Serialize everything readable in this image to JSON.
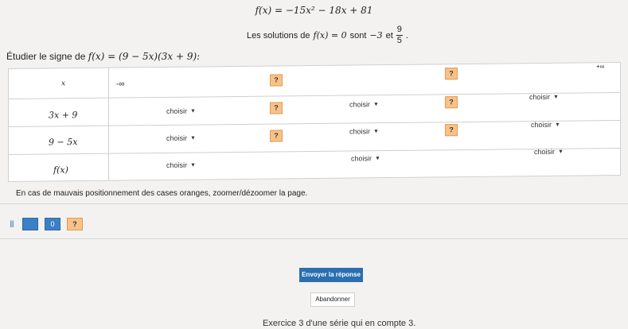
{
  "header": {
    "function_def": "f(x) = −15x² − 18x + 81",
    "solutions_prefix": "Les solutions de",
    "solutions_fx": "f(x) = 0",
    "solutions_mid": "sont",
    "solution_1": "−3",
    "solutions_and": "et",
    "solution_2_num": "9",
    "solution_2_den": "5",
    "solutions_end": "."
  },
  "task": {
    "text": "Étudier le signe de",
    "expression": "f(x) = (9 − 5x)(3x + 9):"
  },
  "table": {
    "x_label": "x",
    "minus_inf": "-∞",
    "plus_inf": "+∞",
    "rows": [
      {
        "label": "3x + 9"
      },
      {
        "label": "9 − 5x"
      },
      {
        "label": "f(x)"
      }
    ],
    "placeholder": "?",
    "select_label": "choisir"
  },
  "hint": "En cas de mauvais positionnement des cases oranges, zoomer/dézoomer la page.",
  "toolbar": {
    "pause": "||",
    "zero": "0",
    "question": "?"
  },
  "buttons": {
    "submit": "Envoyer la réponse",
    "abandon": "Abandonner"
  },
  "footer": "Exercice 3 d'une série qui en compte 3."
}
